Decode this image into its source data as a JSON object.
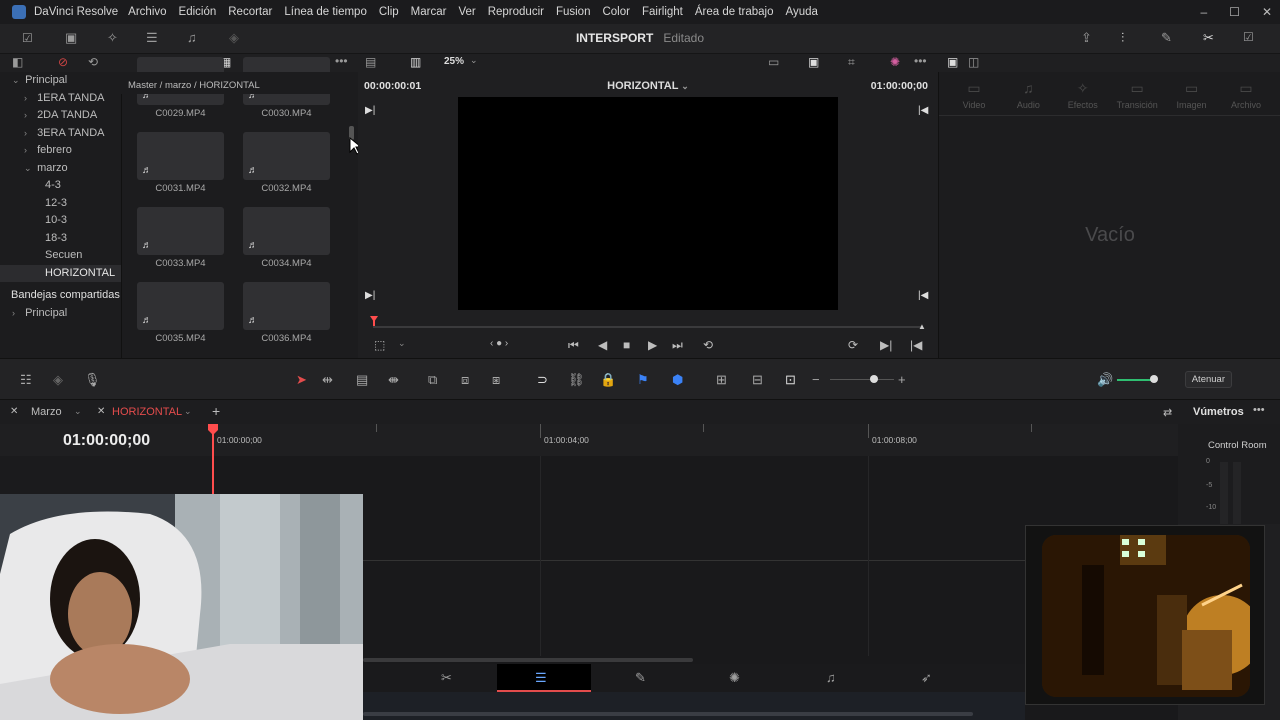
{
  "window": {
    "app_name": "DaVinci Resolve",
    "menu": [
      "Archivo",
      "Edición",
      "Recortar",
      "Línea de tiempo",
      "Clip",
      "Marcar",
      "Ver",
      "Reproducir",
      "Fusion",
      "Color",
      "Fairlight",
      "Área de trabajo",
      "Ayuda"
    ],
    "controls": [
      "–",
      "☐",
      "✕"
    ]
  },
  "project": {
    "name": "INTERSPORT",
    "status": "Editado"
  },
  "toolbar2": {
    "zoom": "25%"
  },
  "sidebar": {
    "items": [
      {
        "label": "Principal",
        "level": 0,
        "expanded": true
      },
      {
        "label": "1ERA TANDA",
        "level": 1
      },
      {
        "label": "2DA TANDA",
        "level": 1
      },
      {
        "label": "3ERA TANDA",
        "level": 1
      },
      {
        "label": "febrero",
        "level": 1
      },
      {
        "label": "marzo",
        "level": 1,
        "expanded": true
      },
      {
        "label": "4-3",
        "level": 2
      },
      {
        "label": "12-3",
        "level": 2
      },
      {
        "label": "10-3",
        "level": 2
      },
      {
        "label": "18-3",
        "level": 2
      },
      {
        "label": "Secuen",
        "level": 2
      },
      {
        "label": "HORIZONTAL",
        "level": 2,
        "selected": true
      }
    ],
    "shared_header": "Bandejas compartidas",
    "shared_items": [
      {
        "label": "Principal"
      }
    ]
  },
  "media_pool": {
    "breadcrumb": "Master / marzo / HORIZONTAL",
    "clips": [
      "C0029.MP4",
      "C0030.MP4",
      "C0031.MP4",
      "C0032.MP4",
      "C0033.MP4",
      "C0034.MP4",
      "C0035.MP4",
      "C0036.MP4"
    ]
  },
  "viewer": {
    "timecode_left": "00:00:00:01",
    "title": "HORIZONTAL",
    "timecode_right": "01:00:00;00"
  },
  "inspector": {
    "tabs": [
      "Video",
      "Audio",
      "Efectos",
      "Transición",
      "Imagen",
      "Archivo"
    ],
    "empty_text": "Vacío"
  },
  "timeline_toolbar": {
    "atenuar": "Atenuar"
  },
  "timeline": {
    "tabs": [
      {
        "label": "Marzo"
      },
      {
        "label": "HORIZONTAL",
        "active": true
      }
    ],
    "timecode": "01:00:00;00",
    "ruler_labels": [
      "01:00:00;00",
      "01:00:04;00",
      "01:00:08;00"
    ]
  },
  "meters": {
    "title": "Vúmetros",
    "room": "Control Room",
    "scale": [
      "0",
      "-5",
      "-10"
    ]
  },
  "colors": {
    "accent_red": "#e34c4c",
    "playhead": "#ff4d4d",
    "panel_bg": "#1c1c1e"
  }
}
